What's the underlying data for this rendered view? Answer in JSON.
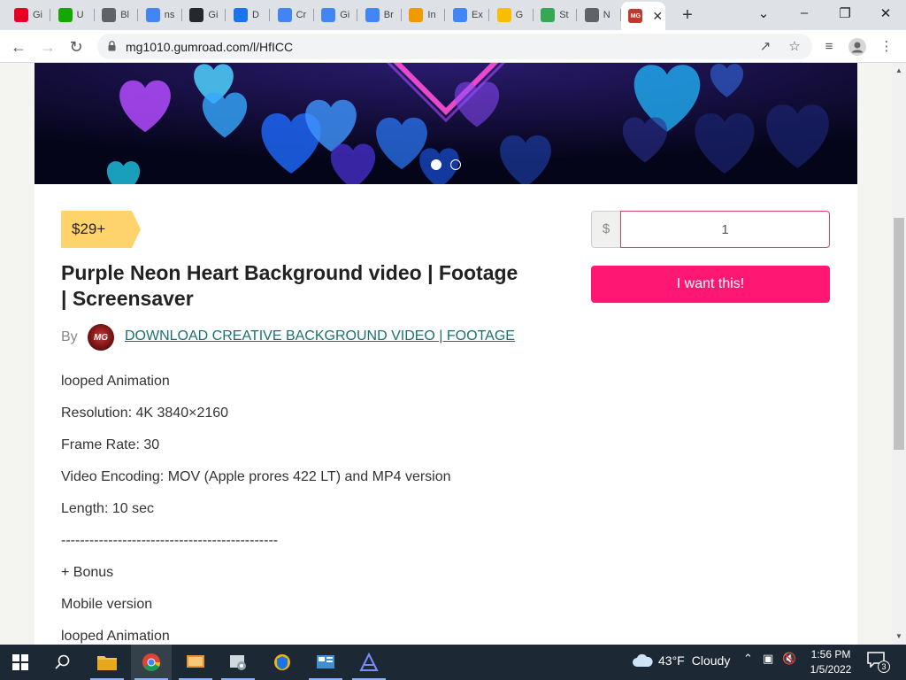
{
  "browser": {
    "tabs": [
      {
        "label": "Gi",
        "icon": "pinterest-icon",
        "color": "#e60023"
      },
      {
        "label": "U",
        "icon": "upwork-icon",
        "color": "#14a800"
      },
      {
        "label": "Bl",
        "icon": "globe-icon",
        "color": "#5f6368"
      },
      {
        "label": "ns",
        "icon": "google-icon",
        "color": "#4285f4"
      },
      {
        "label": "Gi",
        "icon": "github-icon",
        "color": "#24292e"
      },
      {
        "label": "D",
        "icon": "download-icon",
        "color": "#1a73e8"
      },
      {
        "label": "Cr",
        "icon": "google-icon",
        "color": "#4285f4"
      },
      {
        "label": "Gi",
        "icon": "google-icon",
        "color": "#4285f4"
      },
      {
        "label": "Br",
        "icon": "google-icon",
        "color": "#4285f4"
      },
      {
        "label": "In",
        "icon": "shirt-icon",
        "color": "#f29900"
      },
      {
        "label": "Ex",
        "icon": "google-icon",
        "color": "#4285f4"
      },
      {
        "label": "G",
        "icon": "google-ads-icon",
        "color": "#fbbc04"
      },
      {
        "label": "St",
        "icon": "maps-icon",
        "color": "#34a853"
      },
      {
        "label": "N",
        "icon": "chrome-icon",
        "color": "#5f6368"
      },
      {
        "label": "",
        "icon": "mg-logo-icon",
        "color": "#c0392b",
        "active": true
      }
    ],
    "url": "mg1010.gumroad.com/l/HfICC"
  },
  "product": {
    "price": "$29+",
    "title": "Purple Neon Heart Background video | Footage | Screensaver",
    "by_label": "By",
    "author_initials": "MG",
    "author": "DOWNLOAD CREATIVE BACKGROUND VIDEO | FOOTAGE",
    "description": [
      "looped Animation",
      "Resolution: 4K 3840×2160",
      "Frame Rate: 30",
      "Video Encoding: MOV (Apple prores 422 LT) and MP4 version",
      "Length: 10 sec",
      "----------------------------------------------",
      "+ Bonus",
      "Mobile version",
      "looped Animation"
    ],
    "currency_symbol": "$",
    "amount": "1",
    "cta": "I want this!",
    "carousel": {
      "count": 2,
      "active_index": 0
    }
  },
  "taskbar": {
    "weather_temp": "43°F",
    "weather_desc": "Cloudy",
    "time": "1:56 PM",
    "date": "1/5/2022",
    "notification_count": "3"
  }
}
